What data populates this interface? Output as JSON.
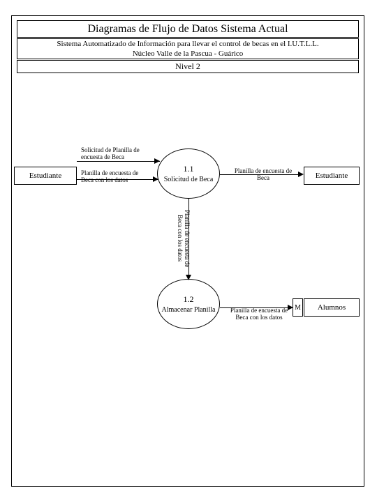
{
  "header": {
    "title": "Diagramas de Flujo de Datos Sistema Actual",
    "subtitle_line1": "Sistema Automatizado de Información para llevar el control de becas en el I.U.T.L.L.",
    "subtitle_line2": "Núcleo Valle de la Pascua - Guárico",
    "level": "Nivel 2"
  },
  "entities": {
    "left": "Estudiante",
    "right": "Estudiante",
    "alumnos": "Alumnos",
    "m": "M"
  },
  "processes": {
    "p1": {
      "num": "1.1",
      "name": "Solicitud de Beca"
    },
    "p2": {
      "num": "1.2",
      "name": "Almacenar Planilla"
    }
  },
  "flows": {
    "f1_line1": "Solicitud de Planilla de",
    "f1_line2": "encuesta de Beca",
    "f2_line1": "Planilla de encuesta de",
    "f2_line2": "Beca con los datos",
    "f3_line1": "Planilla de encuesta de",
    "f3_line2": "Beca",
    "f4_line1": "Planilla de encuesta de",
    "f4_line2": "Beca con los datos",
    "f5_line1": "Planilla de encuesta de",
    "f5_line2": "Beca con los datos"
  }
}
